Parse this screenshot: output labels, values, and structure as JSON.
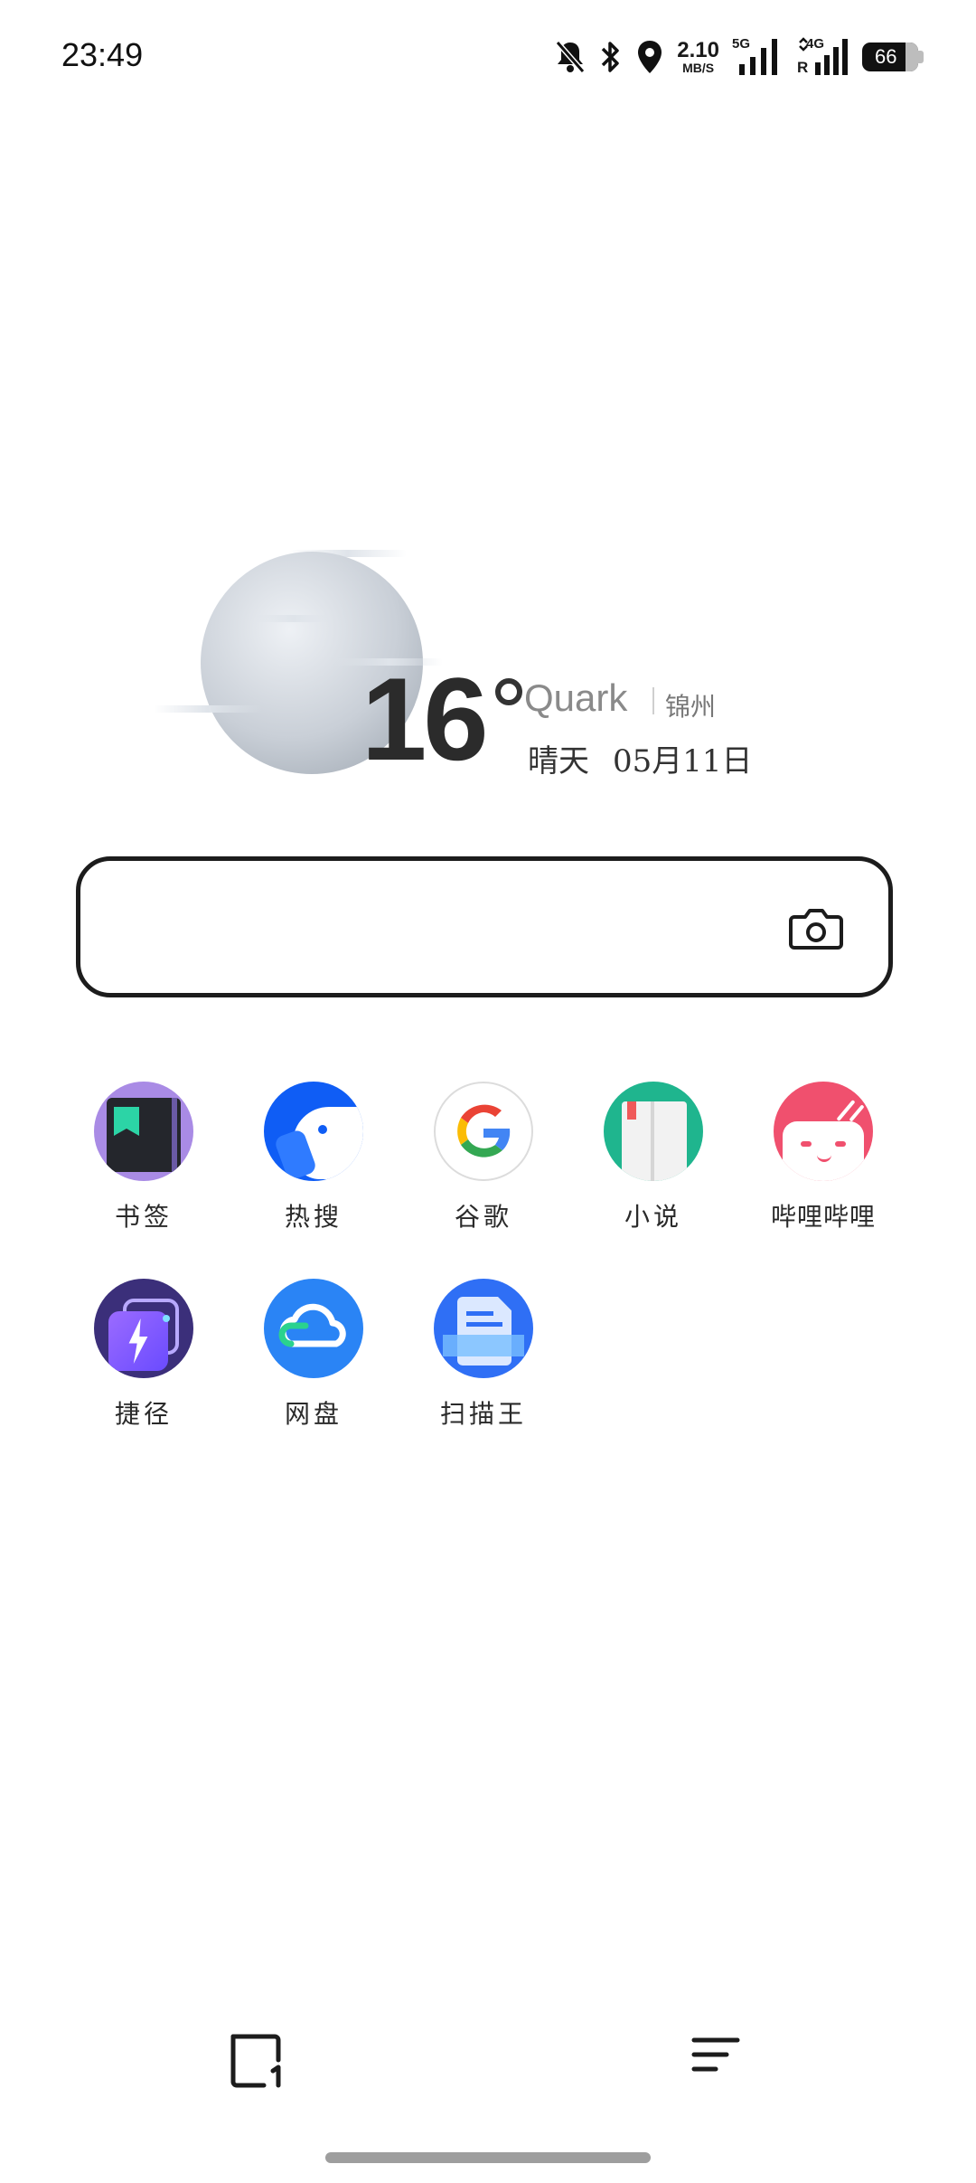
{
  "status_bar": {
    "time": "23:49",
    "net_speed_value": "2.10",
    "net_speed_unit": "MB/S",
    "signal1_label": "5G",
    "signal2_label": "4G",
    "signal2_sub": "R",
    "battery_percent": "66"
  },
  "weather": {
    "temperature": "16",
    "brand": "Quark",
    "city": "锦州",
    "condition": "晴天",
    "date": "05月11日"
  },
  "search": {
    "placeholder": ""
  },
  "shortcuts": [
    {
      "label": "书签",
      "icon": "bookmark-icon"
    },
    {
      "label": "热搜",
      "icon": "hot-search-icon"
    },
    {
      "label": "谷歌",
      "icon": "google-icon"
    },
    {
      "label": "小说",
      "icon": "novel-icon"
    },
    {
      "label": "哔哩哔哩",
      "icon": "bilibili-icon"
    },
    {
      "label": "捷径",
      "icon": "shortcut-icon"
    },
    {
      "label": "网盘",
      "icon": "cloud-drive-icon"
    },
    {
      "label": "扫描王",
      "icon": "scanner-icon"
    }
  ],
  "colors": {
    "bilibili": "#f0506e",
    "novel": "#1fb58e",
    "scanner": "#2f6ff5",
    "cloud": "#2a84f5",
    "shortcut_bg": "#3b2f7a",
    "bookmark_bg": "#a98be5"
  }
}
